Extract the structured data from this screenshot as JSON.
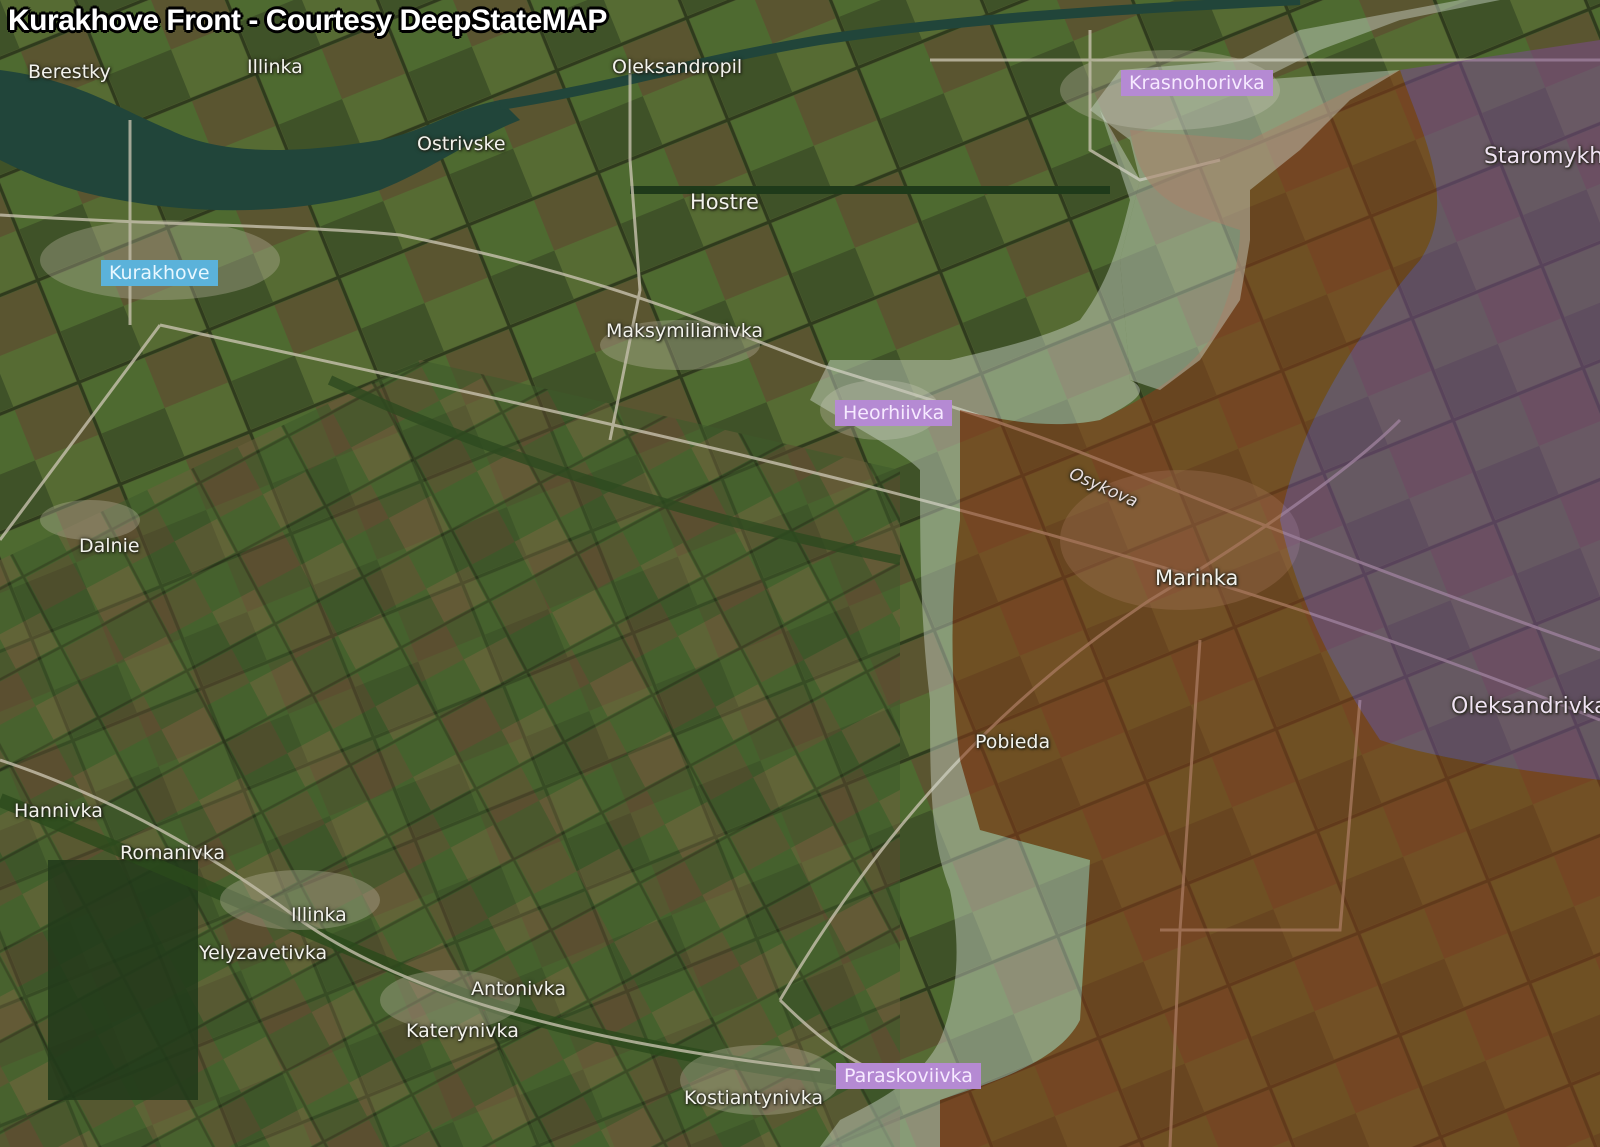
{
  "title": "Kurakhove Front - Courtesy DeepStateMAP",
  "colors": {
    "occupied": "#8a3a1a",
    "occupied_before": "#7a4a8c",
    "gray_zone": "#cfd6cc",
    "ua_label": "#5bb2da",
    "ru_label": "#b58ad3",
    "road": "#cfc8b6",
    "water": "#21453a"
  },
  "places": {
    "berestky": "Berestky",
    "illinka_north": "Illinka",
    "oleksandropil": "Oleksandropil",
    "ostrivske": "Ostrivske",
    "hostre": "Hostre",
    "kurakhove": "Kurakhove",
    "maksymilianivka": "Maksymilianivka",
    "krasnohorivka": "Krasnohorivka",
    "staromykhailivka": "Staromykh",
    "heorhiivka": "Heorhiivka",
    "osykova": "Osykova",
    "marinka": "Marinka",
    "dalnie": "Dalnie",
    "oleksandrivka": "Oleksandrivka",
    "pobieda": "Pobieda",
    "hannivka": "Hannivka",
    "romanivka": "Romanivka",
    "illinka_south": "Illinka",
    "yelyzavetivka": "Yelyzavetivka",
    "antonivka": "Antonivka",
    "katerynivka": "Katerynivka",
    "paraskoviivka": "Paraskoviivka",
    "kostiantynivka": "Kostiantynivka"
  }
}
